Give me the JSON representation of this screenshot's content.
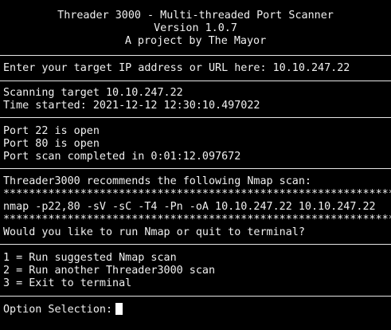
{
  "header": {
    "title": "Threader 3000 - Multi-threaded Port Scanner",
    "version": "Version 1.0.7",
    "author": "A project by The Mayor"
  },
  "target_prompt": "Enter your target IP address or URL here: 10.10.247.22",
  "scan": {
    "target": "Scanning target 10.10.247.22",
    "time_started": "Time started: 2021-12-12 12:30:10.497022"
  },
  "results": {
    "port1": "Port 22 is open",
    "port2": "Port 80 is open",
    "completed": "Port scan completed in 0:01:12.097672"
  },
  "recommendation": {
    "intro": "Threader3000 recommends the following Nmap scan:",
    "stars_top": "****************************************************************",
    "command": "nmap -p22,80 -sV -sC -T4 -Pn -oA 10.10.247.22 10.10.247.22",
    "stars_bottom": "****************************************************************",
    "question": "Would you like to run Nmap or quit to terminal?"
  },
  "menu": {
    "option1": "1 = Run suggested Nmap scan",
    "option2": "2 = Run another Threader3000 scan",
    "option3": "3 = Exit to terminal"
  },
  "prompt": {
    "label": "Option Selection:"
  }
}
